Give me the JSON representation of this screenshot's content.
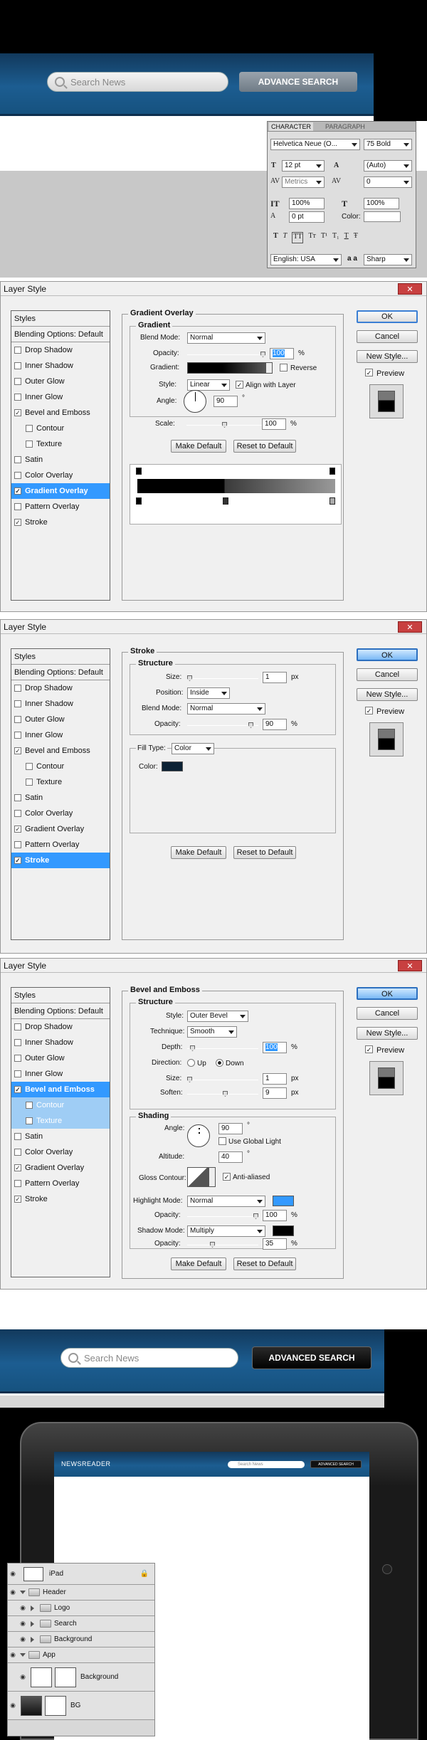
{
  "header1": {
    "search_placeholder": "Search News",
    "button_label": "ADVANCE SEARCH"
  },
  "character_panel": {
    "tabs": [
      "CHARACTER",
      "PARAGRAPH"
    ],
    "font_family": "Helvetica Neue (O...",
    "font_style": "75 Bold",
    "font_size": "12 pt",
    "leading": "(Auto)",
    "kerning": "Metrics",
    "tracking": "0",
    "vertical_scale": "100%",
    "horizontal_scale": "100%",
    "baseline": "0 pt",
    "color_label": "Color:",
    "type_buttons": [
      "T",
      "T",
      "TT",
      "Tт",
      "T¹",
      "T₁",
      "T",
      "Ŧ"
    ],
    "language": "English: USA",
    "aa_label": "a a",
    "antialias": "Sharp"
  },
  "dialog_title": "Layer Style",
  "styles_list": {
    "header": "Styles",
    "items": [
      "Blending Options: Default",
      "Drop Shadow",
      "Inner Shadow",
      "Outer Glow",
      "Inner Glow",
      "Bevel and Emboss",
      "Contour",
      "Texture",
      "Satin",
      "Color Overlay",
      "Gradient Overlay",
      "Pattern Overlay",
      "Stroke"
    ]
  },
  "buttons": {
    "ok": "OK",
    "cancel": "Cancel",
    "new_style": "New Style...",
    "preview": "Preview",
    "make_default": "Make Default",
    "reset_default": "Reset to Default"
  },
  "gradient_overlay": {
    "title": "Gradient Overlay",
    "group": "Gradient",
    "blend_mode_label": "Blend Mode:",
    "blend_mode": "Normal",
    "opacity_label": "Opacity:",
    "opacity": "100",
    "pct": "%",
    "gradient_label": "Gradient:",
    "reverse": "Reverse",
    "style_label": "Style:",
    "style": "Linear",
    "align": "Align with Layer",
    "angle_label": "Angle:",
    "angle": "90",
    "deg": "°",
    "scale_label": "Scale:",
    "scale": "100"
  },
  "stroke": {
    "title": "Stroke",
    "group": "Structure",
    "size_label": "Size:",
    "size": "1",
    "px": "px",
    "position_label": "Position:",
    "position": "Inside",
    "blend_mode_label": "Blend Mode:",
    "blend_mode": "Normal",
    "opacity_label": "Opacity:",
    "opacity": "90",
    "fill_type_label": "Fill Type:",
    "fill_type": "Color",
    "color_label": "Color:",
    "color": "#0c2235"
  },
  "bevel": {
    "title": "Bevel and Emboss",
    "group": "Structure",
    "style_label": "Style:",
    "style": "Outer Bevel",
    "technique_label": "Technique:",
    "technique": "Smooth",
    "depth_label": "Depth:",
    "depth": "100",
    "direction_label": "Direction:",
    "up": "Up",
    "down": "Down",
    "size_label": "Size:",
    "size": "1",
    "soften_label": "Soften:",
    "soften": "9",
    "shading": "Shading",
    "angle_label": "Angle:",
    "angle": "90",
    "global_light": "Use Global Light",
    "altitude_label": "Altitude:",
    "altitude": "40",
    "gloss_label": "Gloss Contour:",
    "anti_aliased": "Anti-aliased",
    "highlight_label": "Highlight Mode:",
    "highlight_mode": "Normal",
    "highlight_color": "#3399ff",
    "h_opacity": "100",
    "shadow_label": "Shadow Mode:",
    "shadow_mode": "Multiply",
    "shadow_color": "#000000",
    "s_opacity": "35"
  },
  "header2": {
    "search_placeholder": "Search News",
    "button_label": "ADVANCED SEARCH"
  },
  "ipad": {
    "logo": "NEWSREADER",
    "search_placeholder": "Search News",
    "button_label": "ADVANCED SEARCH"
  },
  "layers": [
    "iPad",
    "Header",
    "Logo",
    "Search",
    "Background",
    "App",
    "Background",
    "BG"
  ]
}
